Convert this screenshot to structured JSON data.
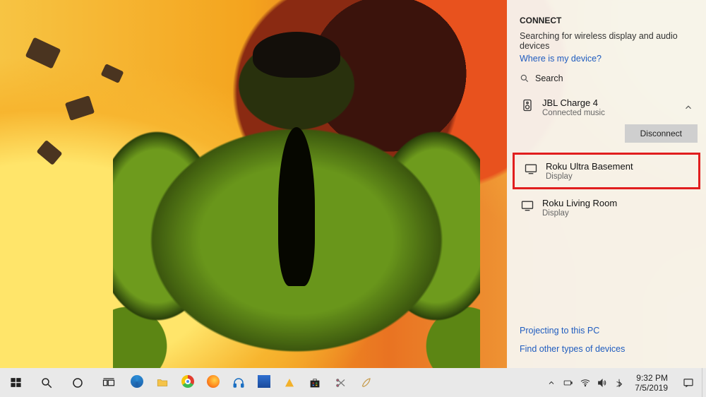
{
  "connect": {
    "title": "CONNECT",
    "status": "Searching for wireless display and audio devices",
    "help_link": "Where is my device?",
    "search_label": "Search",
    "connected_device": {
      "name": "JBL Charge 4",
      "status": "Connected music",
      "expanded": true,
      "disconnect_label": "Disconnect"
    },
    "devices": [
      {
        "name": "Roku Ultra Basement",
        "kind": "Display",
        "highlighted": true
      },
      {
        "name": "Roku Living Room",
        "kind": "Display",
        "highlighted": false
      }
    ],
    "projecting_link": "Projecting to this PC",
    "find_other_link": "Find other types of devices"
  },
  "taskbar": {
    "start_tooltip": "Start",
    "search_tooltip": "Search",
    "cortana_tooltip": "Cortana",
    "taskview_tooltip": "Task View",
    "pinned": [
      "Edge",
      "File Explorer",
      "Chrome",
      "Firefox",
      "Groove",
      "Paint",
      "Steam",
      "Store",
      "Snip",
      "Sketch"
    ],
    "clock": {
      "time": "9:32 PM",
      "date": "7/5/2019"
    }
  }
}
